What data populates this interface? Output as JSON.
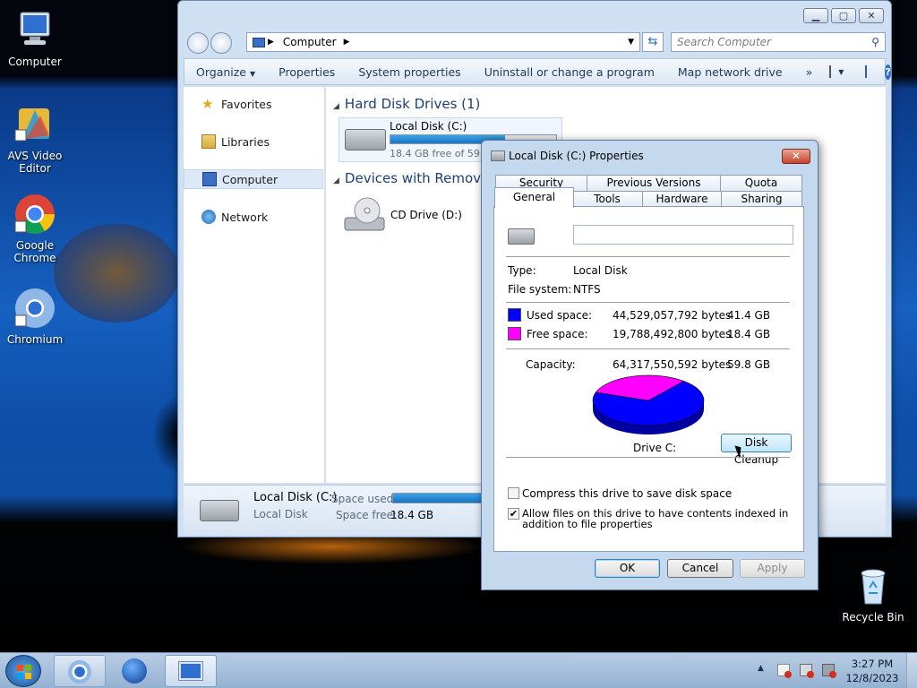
{
  "desktop": {
    "icons": [
      {
        "label": "Computer"
      },
      {
        "label": "AVS Video Editor"
      },
      {
        "label": "Google Chrome"
      },
      {
        "label": "Chromium"
      },
      {
        "label": "Recycle Bin"
      }
    ]
  },
  "explorer": {
    "breadcrumb": "Computer",
    "search_placeholder": "Search Computer",
    "toolbar": [
      "Organize",
      "Properties",
      "System properties",
      "Uninstall or change a program",
      "Map network drive"
    ],
    "more": "»",
    "nav": [
      "Favorites",
      "Libraries",
      "Computer",
      "Network"
    ],
    "groups": [
      "Hard Disk Drives (1)",
      "Devices with Removable Storage (1)"
    ],
    "drive_c": {
      "name": "Local Disk (C:)",
      "free_text": "18.4 GB free of 59.8 GB",
      "used_fraction": 0.69
    },
    "drive_d": {
      "name": "CD Drive (D:)"
    },
    "details": {
      "name": "Local Disk (C:)",
      "type": "Local Disk",
      "space_used_label": "Space used:",
      "space_free_label": "Space free:",
      "space_free": "18.4 GB",
      "used_fraction": 0.69
    }
  },
  "dialog": {
    "title": "Local Disk (C:) Properties",
    "tabs_back": [
      "Security",
      "Previous Versions",
      "Quota"
    ],
    "tabs_front": [
      "General",
      "Tools",
      "Hardware",
      "Sharing"
    ],
    "name_value": "",
    "type_label": "Type:",
    "type_value": "Local Disk",
    "fs_label": "File system:",
    "fs_value": "NTFS",
    "used_label": "Used space:",
    "used_bytes": "44,529,057,792 bytes",
    "used_gb": "41.4 GB",
    "free_label": "Free space:",
    "free_bytes": "19,788,492,800 bytes",
    "free_gb": "18.4 GB",
    "cap_label": "Capacity:",
    "cap_bytes": "64,317,550,592 bytes",
    "cap_gb": "59.8 GB",
    "drive_label": "Drive C:",
    "cleanup": "Disk Cleanup",
    "compress_label": "Compress this drive to save disk space",
    "compress_checked": false,
    "index_label": "Allow files on this drive to have contents indexed in addition to file properties",
    "index_checked": true,
    "ok": "OK",
    "cancel": "Cancel",
    "apply": "Apply",
    "colors": {
      "used": "#0000ff",
      "free": "#ff00ff"
    }
  },
  "taskbar": {
    "time": "3:27 PM",
    "date": "12/8/2023"
  },
  "chart_data": {
    "type": "pie",
    "categories": [
      "Used space",
      "Free space"
    ],
    "values": [
      41.4,
      18.4
    ],
    "title": "Drive C:"
  }
}
